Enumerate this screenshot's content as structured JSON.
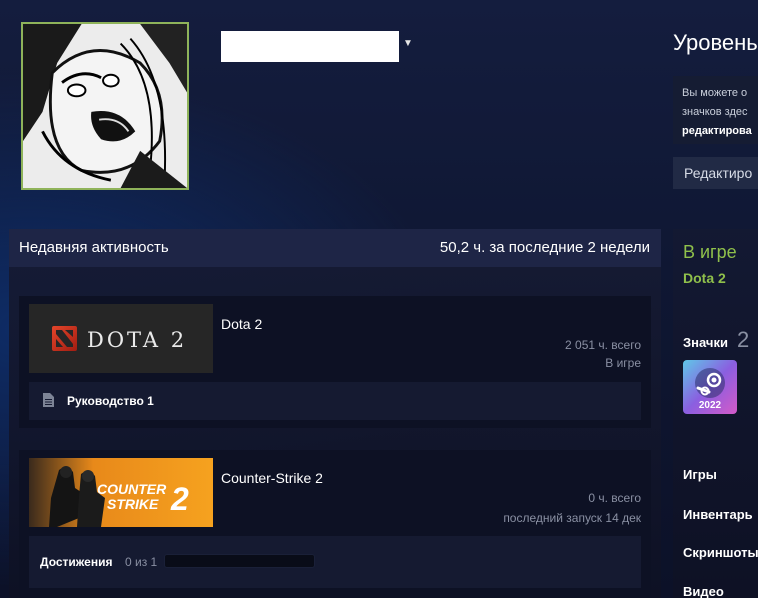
{
  "profile": {
    "avatar_alt": "avatar",
    "name_dropdown_icon": "caret-down-icon"
  },
  "level": {
    "title": "Уровень",
    "desc_line1": "Вы можете о",
    "desc_line2": "значков здес",
    "desc_line3": "редактирова",
    "edit_button": "Редактиро"
  },
  "activity": {
    "title": "Недавняя активность",
    "hours": "50,2 ч. за последние 2 недели",
    "games": [
      {
        "name": "Dota 2",
        "logo_text": "DOTA 2",
        "total": "2 051 ч. всего",
        "status": "В игре",
        "guide_label": "Руководство 1"
      },
      {
        "name": "Counter-Strike 2",
        "logo_line1": "COUNTER",
        "logo_line2": "STRIKE",
        "logo_num": "2",
        "total": "0 ч. всего",
        "status": "последний запуск 14 дек",
        "achievements_label": "Достижения",
        "achievements_count": "0 из 1",
        "achievements_progress": 0
      }
    ]
  },
  "sidebar": {
    "in_game_title": "В игре",
    "in_game_name": "Dota 2",
    "badges_label": "Значки",
    "badges_count": "2",
    "badge_year": "2022",
    "links": [
      "Игры",
      "Инвентарь",
      "Скриншоты",
      "Видео"
    ]
  },
  "colors": {
    "accent_green": "#8fc04b",
    "avatar_border": "#8fb35a",
    "cs_orange": "#f39a1c"
  }
}
